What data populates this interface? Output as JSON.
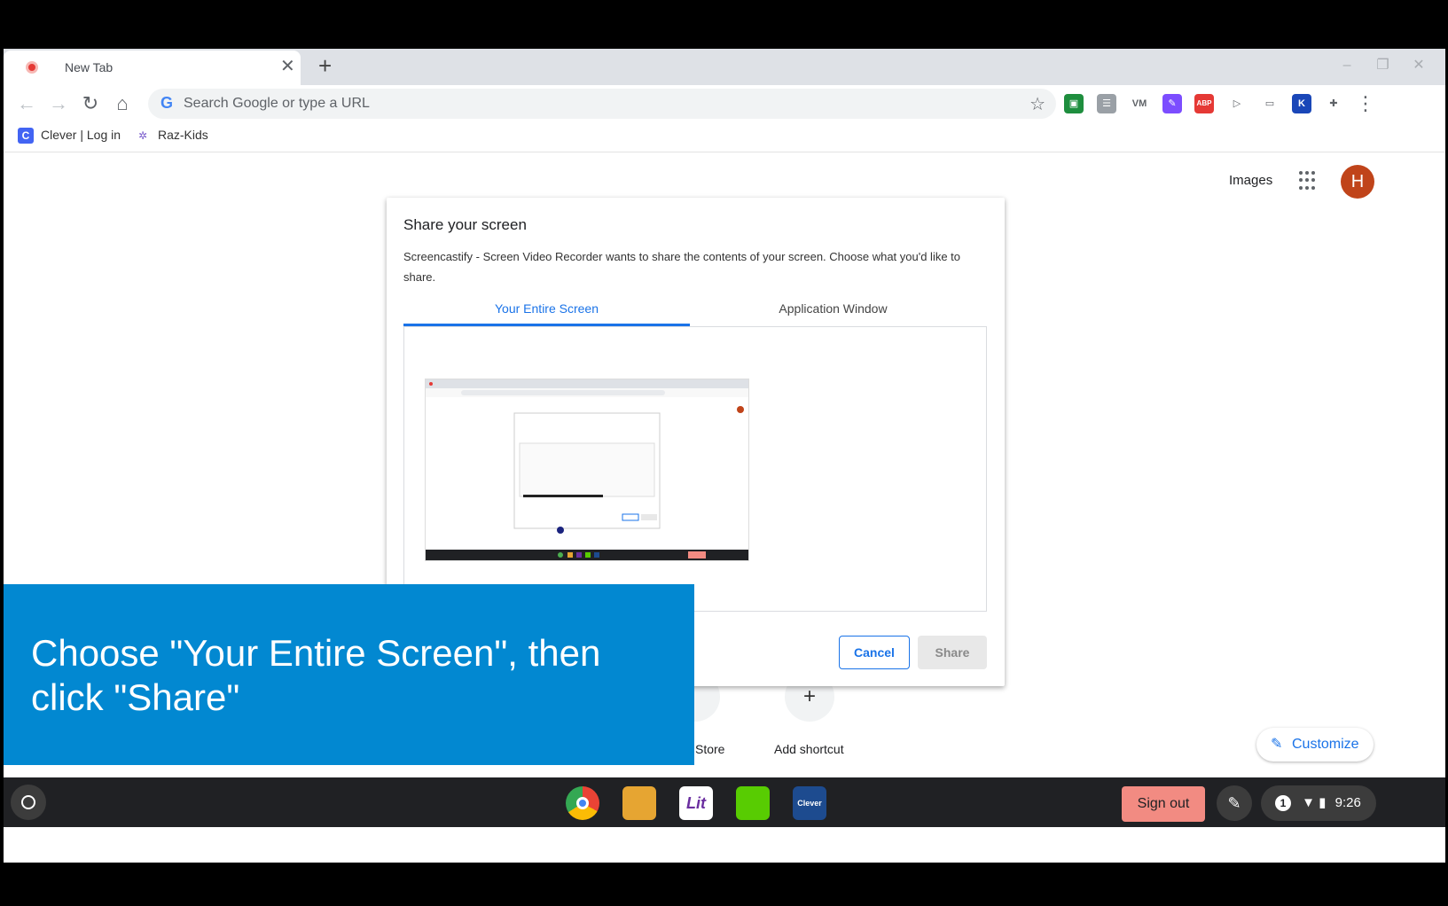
{
  "browser": {
    "tab_title": "New Tab",
    "tab_close": "✕",
    "new_tab": "+",
    "window_controls": [
      "–",
      "❐",
      "✕"
    ],
    "omnibox_placeholder": "Search Google or type a URL",
    "omnibox_g": "G",
    "bookmark_star": "☆",
    "nav": {
      "back": "←",
      "forward": "→",
      "reload": "↻",
      "home": "⌂"
    },
    "menu": "⋮",
    "extensions": [
      {
        "name": "classroom-extension-icon",
        "glyph": "▣",
        "color": "#1e8e3e"
      },
      {
        "name": "reader-extension-icon",
        "glyph": "☰",
        "color": "#9aa0a6"
      },
      {
        "name": "vm-extension-icon",
        "glyph": "VM",
        "color": "#ffffff"
      },
      {
        "name": "screencastify-extension-icon",
        "glyph": "✎",
        "color": "#7c4dff"
      },
      {
        "name": "adblock-plus-icon",
        "glyph": "ABP",
        "color": "#e53935"
      },
      {
        "name": "record-extension-icon",
        "glyph": "▷",
        "color": "#ffffff"
      },
      {
        "name": "cast-extension-icon",
        "glyph": "▭",
        "color": "#ffffff"
      },
      {
        "name": "k-extension-icon",
        "glyph": "K",
        "color": "#1a47b8"
      },
      {
        "name": "puzzle-extensions-icon",
        "glyph": "✚",
        "color": "#ffffff"
      }
    ]
  },
  "bookmarks": [
    {
      "label": "Clever | Log in",
      "glyph": "C",
      "color": "#4264f3"
    },
    {
      "label": "Raz-Kids",
      "glyph": "✲",
      "color": "#ffffff"
    }
  ],
  "ntp": {
    "images_link": "Images",
    "avatar_letter": "H",
    "shortcuts": [
      {
        "label": "Store",
        "glyph": ""
      },
      {
        "label": "Add shortcut",
        "glyph": "+"
      }
    ],
    "customize": "Customize",
    "customize_icon": "✎"
  },
  "dialog": {
    "title": "Share your screen",
    "description": "Screencastify - Screen Video Recorder wants to share the contents of your screen. Choose what you'd like to share.",
    "tabs": [
      "Your Entire Screen",
      "Application Window"
    ],
    "cancel": "Cancel",
    "share": "Share"
  },
  "caption": "Choose \"Your Entire Screen\", then click \"Share\"",
  "shelf": {
    "apps": [
      {
        "name": "chrome-app-icon",
        "glyph": "",
        "color": "#ffffff"
      },
      {
        "name": "app-2-icon",
        "glyph": "",
        "color": "#e6a532"
      },
      {
        "name": "app-3-icon",
        "glyph": "Lit",
        "color": "#6b2fa0"
      },
      {
        "name": "duolingo-app-icon",
        "glyph": "",
        "color": "#58cc02"
      },
      {
        "name": "clever-app-icon",
        "glyph": "Clever",
        "color": "#1d4b8f"
      }
    ],
    "sign_out": "Sign out",
    "stylus": "✎",
    "notification_count": "1",
    "tray_icons": "▼ ▮",
    "time": "9:26"
  }
}
